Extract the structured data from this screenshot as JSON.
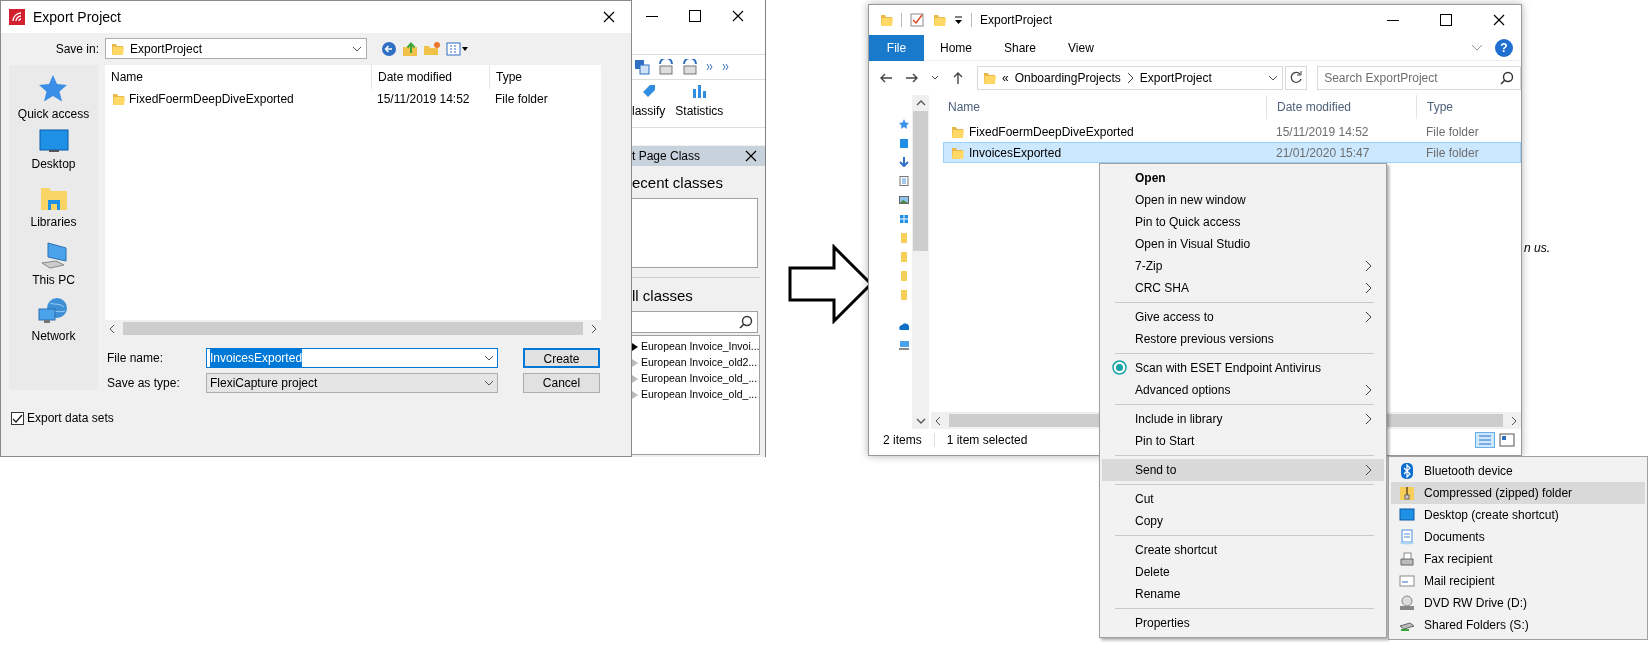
{
  "export_dialog": {
    "title": "Export Project",
    "save_in_label": "Save in:",
    "save_in_value": "ExportProject",
    "places": [
      {
        "label": "Quick access",
        "kind": "quick_access"
      },
      {
        "label": "Desktop",
        "kind": "desktop"
      },
      {
        "label": "Libraries",
        "kind": "libraries"
      },
      {
        "label": "This PC",
        "kind": "this_pc"
      },
      {
        "label": "Network",
        "kind": "network"
      }
    ],
    "columns": [
      "Name",
      "Date modified",
      "Type"
    ],
    "rows": [
      {
        "name": "FixedFoermDeepDiveExported",
        "date_modified": "15/11/2019 14:52",
        "type": "File folder"
      }
    ],
    "file_name_label": "File name:",
    "file_name_value": "InvoicesExported",
    "save_as_type_label": "Save as type:",
    "save_as_type_value": "FlexiCapture project",
    "buttons": [
      {
        "label": "Create",
        "default": true
      },
      {
        "label": "Cancel",
        "default": false
      }
    ],
    "export_data_sets": {
      "label": "Export data sets",
      "checked": true
    }
  },
  "background_app": {
    "ribbon_buttons": [
      {
        "label": "lassify",
        "kind": "tag"
      },
      {
        "label": "Statistics",
        "kind": "chart"
      }
    ],
    "panel_title": "t Page Class",
    "recent_label": "ecent classes",
    "all_label": "ll classes",
    "classes": [
      {
        "name": "European Invoice_Invoi...",
        "selected": true
      },
      {
        "name": "European Invoice_old2...",
        "selected": false
      },
      {
        "name": "European Invoice_old_...",
        "selected": false
      },
      {
        "name": "European Invoice_old_...",
        "selected": false
      }
    ]
  },
  "background_text": "n us.",
  "explorer": {
    "title": "ExportProject",
    "help_label": "?",
    "ribbon_tabs": [
      {
        "label": "File",
        "kind": "file"
      },
      {
        "label": "Home",
        "kind": "tab"
      },
      {
        "label": "Share",
        "kind": "tab"
      },
      {
        "label": "View",
        "kind": "tab"
      }
    ],
    "address": {
      "prefix": "«",
      "parts": [
        "OnboardingProjects",
        "ExportProject"
      ]
    },
    "search": {
      "placeholder": "Search ExportProject"
    },
    "columns": [
      "Name",
      "Date modified",
      "Type"
    ],
    "rows": [
      {
        "name": "FixedFoermDeepDiveExported",
        "date_modified": "15/11/2019 14:52",
        "type": "File folder",
        "selected": false
      },
      {
        "name": "InvoicesExported",
        "date_modified": "21/01/2020 15:47",
        "type": "File folder",
        "selected": true
      }
    ],
    "status": {
      "count": "2 items",
      "selection": "1 item selected"
    }
  },
  "context_menu": {
    "groups": [
      {
        "items": [
          {
            "label": "Open",
            "kind": "command",
            "default": true,
            "submenu": false,
            "selected": false
          },
          {
            "label": "Open in new window",
            "kind": "command",
            "default": false,
            "submenu": false,
            "selected": false
          },
          {
            "label": "Pin to Quick access",
            "kind": "command",
            "default": false,
            "submenu": false,
            "selected": false
          },
          {
            "label": "Open in Visual Studio",
            "kind": "command",
            "default": false,
            "submenu": false,
            "selected": false
          },
          {
            "label": "7-Zip",
            "kind": "command",
            "default": false,
            "submenu": true,
            "selected": false
          },
          {
            "label": "CRC SHA",
            "kind": "command",
            "default": false,
            "submenu": true,
            "selected": false
          }
        ]
      },
      {
        "items": [
          {
            "label": "Give access to",
            "kind": "command",
            "default": false,
            "submenu": true,
            "selected": false
          },
          {
            "label": "Restore previous versions",
            "kind": "command",
            "default": false,
            "submenu": false,
            "selected": false
          }
        ]
      },
      {
        "items": [
          {
            "label": "Scan with ESET Endpoint Antivirus",
            "kind": "antivirus",
            "default": false,
            "submenu": false,
            "selected": false
          },
          {
            "label": "Advanced options",
            "kind": "command",
            "default": false,
            "submenu": true,
            "selected": false
          }
        ]
      },
      {
        "items": [
          {
            "label": "Include in library",
            "kind": "command",
            "default": false,
            "submenu": true,
            "selected": false
          },
          {
            "label": "Pin to Start",
            "kind": "command",
            "default": false,
            "submenu": false,
            "selected": false
          }
        ]
      },
      {
        "items": [
          {
            "label": "Send to",
            "kind": "command",
            "default": false,
            "submenu": true,
            "selected": true
          }
        ]
      },
      {
        "items": [
          {
            "label": "Cut",
            "kind": "command",
            "default": false,
            "submenu": false,
            "selected": false
          },
          {
            "label": "Copy",
            "kind": "command",
            "default": false,
            "submenu": false,
            "selected": false
          }
        ]
      },
      {
        "items": [
          {
            "label": "Create shortcut",
            "kind": "command",
            "default": false,
            "submenu": false,
            "selected": false
          },
          {
            "label": "Delete",
            "kind": "command",
            "default": false,
            "submenu": false,
            "selected": false
          },
          {
            "label": "Rename",
            "kind": "command",
            "default": false,
            "submenu": false,
            "selected": false
          }
        ]
      },
      {
        "items": [
          {
            "label": "Properties",
            "kind": "command",
            "default": false,
            "submenu": false,
            "selected": false
          }
        ]
      }
    ]
  },
  "send_to_menu": {
    "items": [
      {
        "label": "Bluetooth device",
        "kind": "bluetooth",
        "selected": false
      },
      {
        "label": "Compressed (zipped) folder",
        "kind": "zip",
        "selected": true
      },
      {
        "label": "Desktop (create shortcut)",
        "kind": "desktop",
        "selected": false
      },
      {
        "label": "Documents",
        "kind": "documents",
        "selected": false
      },
      {
        "label": "Fax recipient",
        "kind": "fax",
        "selected": false
      },
      {
        "label": "Mail recipient",
        "kind": "mail",
        "selected": false
      },
      {
        "label": "DVD RW Drive (D:)",
        "kind": "dvd",
        "selected": false
      },
      {
        "label": "Shared Folders (S:)",
        "kind": "share",
        "selected": false
      }
    ]
  }
}
